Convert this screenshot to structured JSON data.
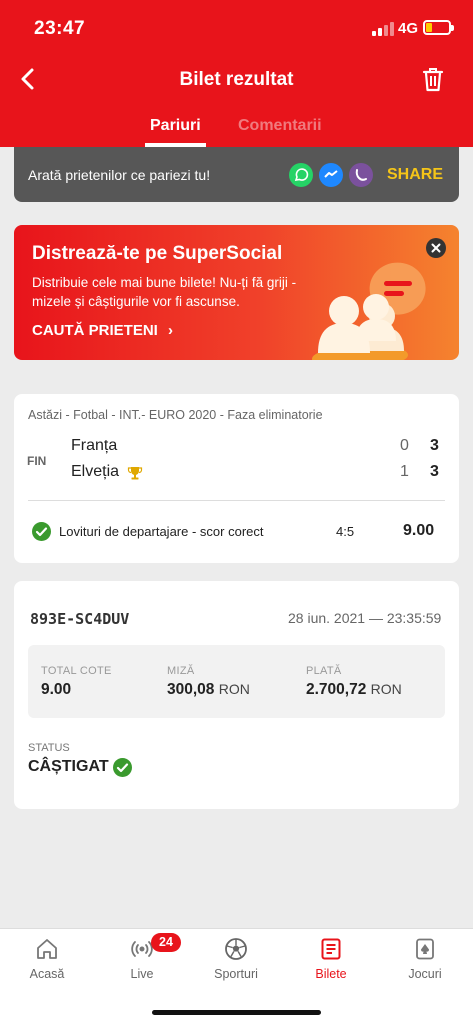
{
  "status_bar": {
    "time": "23:47",
    "network": "4G"
  },
  "header": {
    "title": "Bilet rezultat",
    "back_icon": "chevron-left-icon",
    "delete_icon": "trash-icon",
    "tabs": [
      {
        "label": "Pariuri",
        "active": true
      },
      {
        "label": "Comentarii",
        "active": false
      }
    ]
  },
  "share_bar": {
    "text": "Arată prietenilor ce pariezi tu!",
    "icons": [
      "whatsapp-icon",
      "messenger-icon",
      "viber-icon"
    ],
    "share_label": "SHARE"
  },
  "promo": {
    "title": "Distrează-te pe SuperSocial",
    "text": "Distribuie cele mai bune bilete! Nu-ți fă griji - mizele și câștigurile vor fi ascunse.",
    "link_label": "CAUTĂ PRIETENI",
    "link_chevron": "›"
  },
  "match": {
    "meta": "Astăzi - Fotbal - INT.- EURO 2020 - Faza eliminatorie",
    "status": "FIN",
    "teams": [
      {
        "name": "Franța",
        "score_ht": "0",
        "score_ft": "3"
      },
      {
        "name": "Elveția",
        "score_ht": "1",
        "score_ft": "3",
        "winner_icon": "trophy-icon"
      }
    ],
    "bet": {
      "market": "Lovituri de departajare - scor corect",
      "pick": "4:5",
      "odds": "9.00",
      "result": "won"
    }
  },
  "ticket": {
    "id": "893E-SC4DUV",
    "date": "28 iun. 2021 — 23:35:59",
    "total_odds_label": "TOTAL COTE",
    "total_odds": "9.00",
    "stake_label": "MIZĂ",
    "stake": "300,08",
    "stake_unit": "RON",
    "payout_label": "PLATĂ",
    "payout": "2.700,72",
    "payout_unit": "RON",
    "status_label": "STATUS",
    "status_value": "CÂȘTIGAT"
  },
  "bottom_nav": {
    "items": [
      {
        "label": "Acasă",
        "icon": "home-icon"
      },
      {
        "label": "Live",
        "icon": "live-icon",
        "badge": "24"
      },
      {
        "label": "Sporturi",
        "icon": "soccer-ball-icon"
      },
      {
        "label": "Bilete",
        "icon": "ticket-icon",
        "active": true
      },
      {
        "label": "Jocuri",
        "icon": "cards-icon"
      }
    ]
  },
  "colors": {
    "brand_red": "#e8141b",
    "share_yellow": "#f5c518",
    "success_green": "#3a9a2e"
  }
}
